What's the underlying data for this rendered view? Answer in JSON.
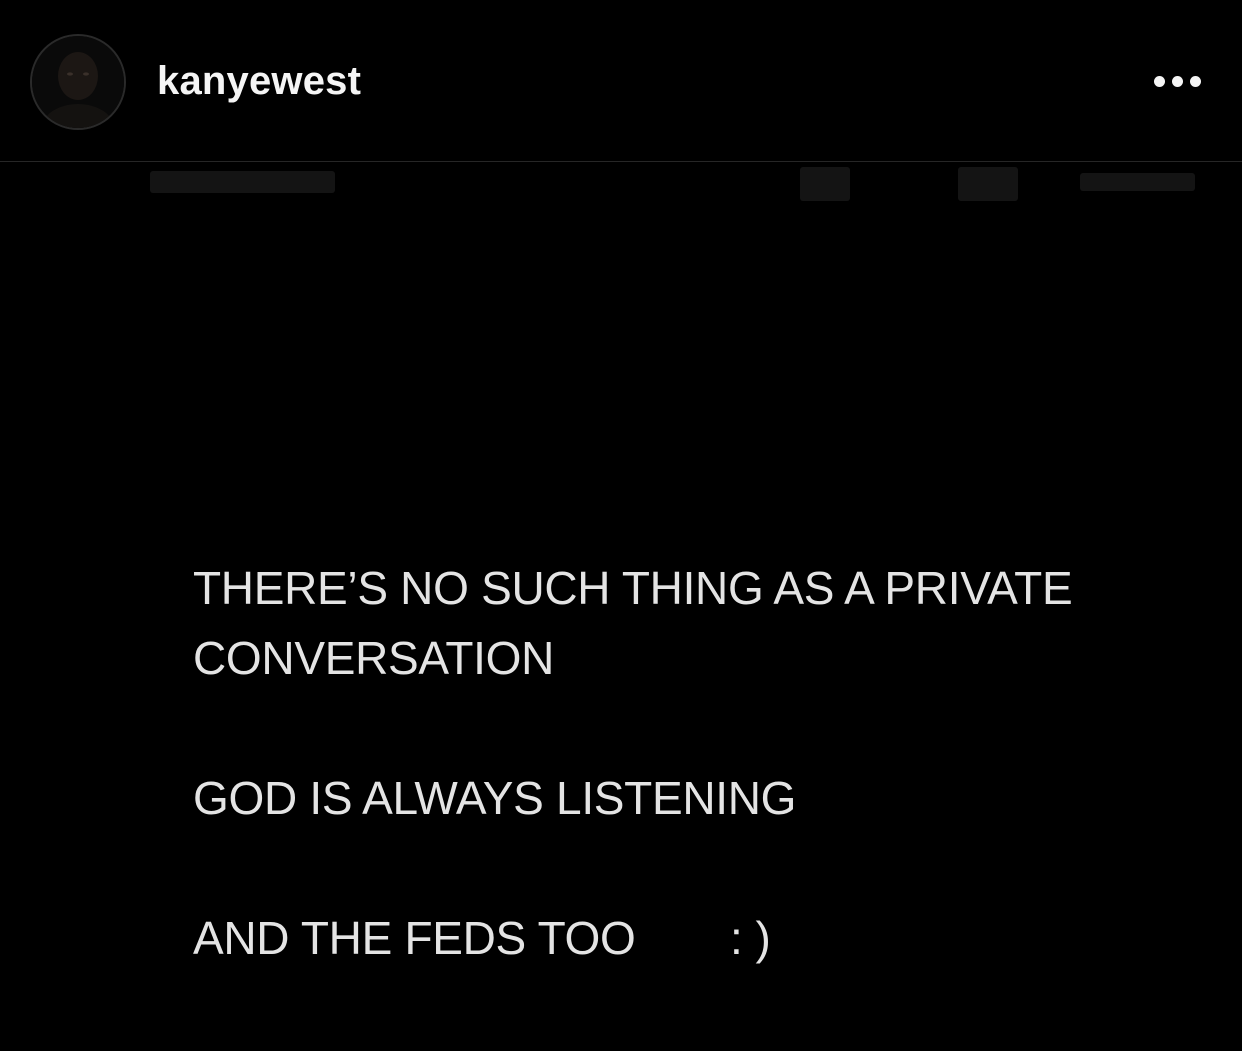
{
  "header": {
    "username": "kanyewest",
    "avatar": "profile-photo",
    "more_icon": "more-horizontal-icon"
  },
  "post": {
    "lines": [
      "THERE’S NO SUCH THING AS A PRIVATE",
      "CONVERSATION",
      "GOD IS ALWAYS LISTENING",
      "AND THE FEDS TOO"
    ],
    "smiley": ": )"
  },
  "colors": {
    "background": "#000000",
    "text": "#e4e4e4",
    "divider": "#262626"
  }
}
